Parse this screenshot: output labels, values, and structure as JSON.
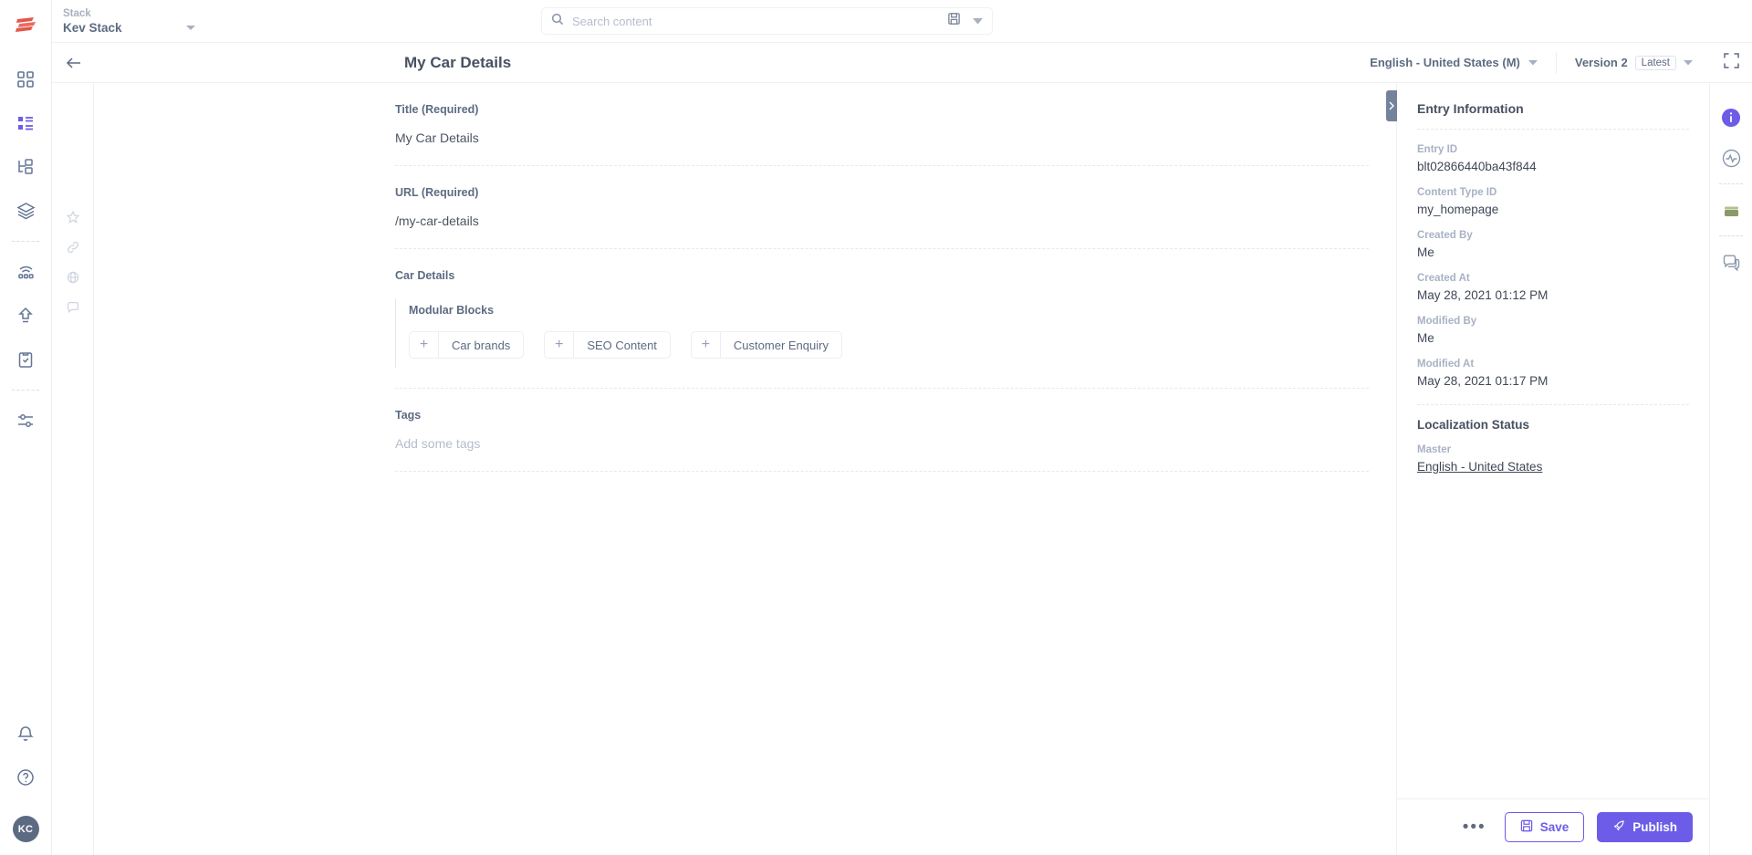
{
  "brand": {
    "accent": "#6c5ce7",
    "logo_icon": "contentstack-logo"
  },
  "topbar": {
    "stack_label": "Stack",
    "stack_name": "Kev Stack",
    "search_placeholder": "Search content",
    "search_value": ""
  },
  "header": {
    "title": "My Car Details",
    "language": "English - United States (M)",
    "version_label": "Version 2",
    "version_badge": "Latest"
  },
  "form": {
    "fields": [
      {
        "label": "Title (Required)",
        "value": "My Car Details",
        "placeholder": false
      },
      {
        "label": "URL (Required)",
        "value": "/my-car-details",
        "placeholder": false
      }
    ],
    "car_details": {
      "label": "Car Details",
      "modular_title": "Modular Blocks",
      "blocks": [
        {
          "label": "Car brands"
        },
        {
          "label": "SEO Content"
        },
        {
          "label": "Customer Enquiry"
        }
      ]
    },
    "tags": {
      "label": "Tags",
      "placeholder": "Add some tags"
    }
  },
  "entry_panel": {
    "title": "Entry Information",
    "meta": [
      {
        "key": "Entry ID",
        "value": "blt02866440ba43f844"
      },
      {
        "key": "Content Type ID",
        "value": "my_homepage"
      },
      {
        "key": "Created By",
        "value": "Me"
      },
      {
        "key": "Created At",
        "value": "May 28, 2021 01:12 PM"
      },
      {
        "key": "Modified By",
        "value": "Me"
      },
      {
        "key": "Modified At",
        "value": "May 28, 2021 01:17 PM"
      }
    ],
    "localization": {
      "title": "Localization Status",
      "key": "Master",
      "value": "English - United States"
    },
    "footer": {
      "more_label": "•••",
      "save_label": "Save",
      "publish_label": "Publish"
    }
  },
  "left_rail": {
    "items": [
      {
        "name": "dashboard-icon",
        "active": false
      },
      {
        "name": "content-entries-icon",
        "active": true
      },
      {
        "name": "content-models-icon",
        "active": false
      },
      {
        "name": "assets-layers-icon",
        "active": false
      },
      {
        "name": "live-preview-icon",
        "active": false
      },
      {
        "name": "releases-upload-icon",
        "active": false
      },
      {
        "name": "workflow-clipboard-icon",
        "active": false
      },
      {
        "name": "settings-sliders-icon",
        "active": false
      }
    ],
    "bottom": [
      {
        "name": "bell-icon"
      },
      {
        "name": "help-icon"
      }
    ],
    "avatar_initials": "KC"
  },
  "gutter_tools": [
    {
      "name": "star-icon"
    },
    {
      "name": "link-icon"
    },
    {
      "name": "globe-icon"
    },
    {
      "name": "comment-icon"
    }
  ],
  "right_rail": {
    "items": [
      {
        "name": "info-icon",
        "active": true
      },
      {
        "name": "activity-icon",
        "active": false
      },
      {
        "name": "extensions-icon",
        "active": false
      },
      {
        "name": "comments-icon",
        "active": false
      }
    ]
  }
}
